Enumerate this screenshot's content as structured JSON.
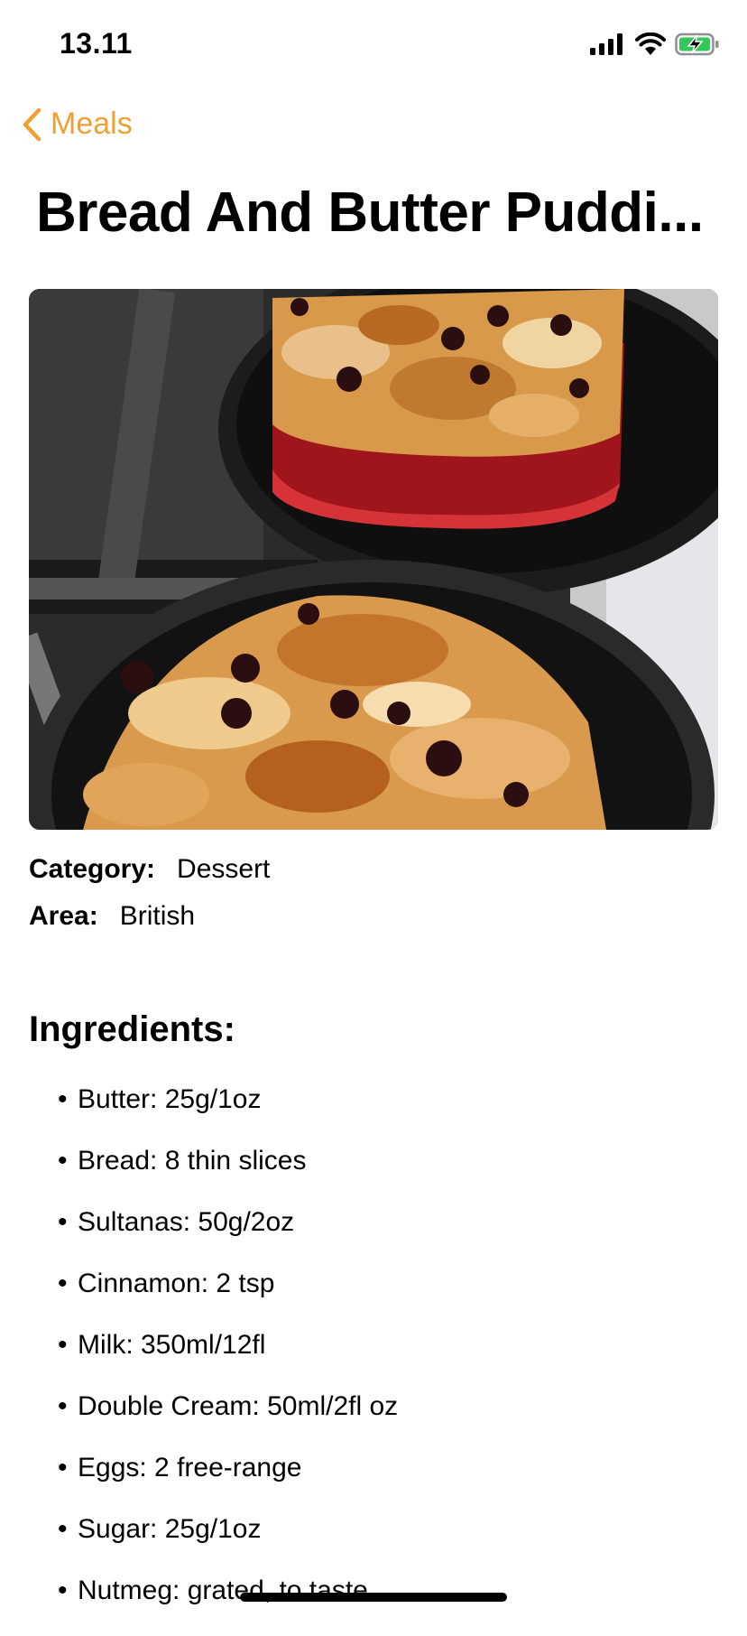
{
  "status_bar": {
    "time": "13.11"
  },
  "nav": {
    "back_label": "Meals"
  },
  "meal": {
    "title": "Bread And Butter Puddi...",
    "category_label": "Category:",
    "category_value": "Dessert",
    "area_label": "Area:",
    "area_value": "British"
  },
  "ingredients": {
    "heading": "Ingredients:",
    "items": [
      "Butter: 25g/1oz",
      "Bread: 8 thin slices",
      "Sultanas: 50g/2oz",
      "Cinnamon: 2 tsp",
      "Milk: 350ml/12fl",
      "Double Cream: 50ml/2fl oz",
      "Eggs: 2 free-range",
      "Sugar: 25g/1oz",
      "Nutmeg: grated, to taste"
    ]
  },
  "colors": {
    "accent": "#f0a033",
    "battery_fill": "#34c759"
  }
}
